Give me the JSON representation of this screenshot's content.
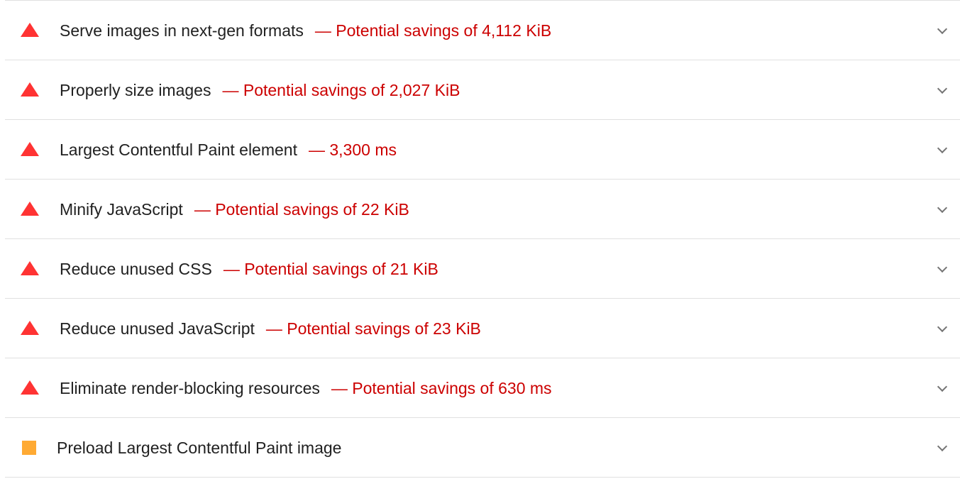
{
  "audits": [
    {
      "rating": "fail",
      "title": "Serve images in next-gen formats",
      "display": "— Potential savings of 4,112 KiB"
    },
    {
      "rating": "fail",
      "title": "Properly size images",
      "display": "— Potential savings of 2,027 KiB"
    },
    {
      "rating": "fail",
      "title": "Largest Contentful Paint element",
      "display": "— 3,300 ms"
    },
    {
      "rating": "fail",
      "title": "Minify JavaScript",
      "display": "— Potential savings of 22 KiB"
    },
    {
      "rating": "fail",
      "title": "Reduce unused CSS",
      "display": "— Potential savings of 21 KiB"
    },
    {
      "rating": "fail",
      "title": "Reduce unused JavaScript",
      "display": "— Potential savings of 23 KiB"
    },
    {
      "rating": "fail",
      "title": "Eliminate render-blocking resources",
      "display": "— Potential savings of 630 ms"
    },
    {
      "rating": "average",
      "title": "Preload Largest Contentful Paint image",
      "display": ""
    }
  ],
  "icons": {
    "fail": "red-triangle-icon",
    "average": "orange-square-icon",
    "expand": "chevron-down-icon"
  },
  "colors": {
    "fail": "#ff3333",
    "average": "#ffaa33",
    "savings_text": "#cc0000",
    "title_text": "#212121",
    "divider": "#e0e0e0"
  }
}
